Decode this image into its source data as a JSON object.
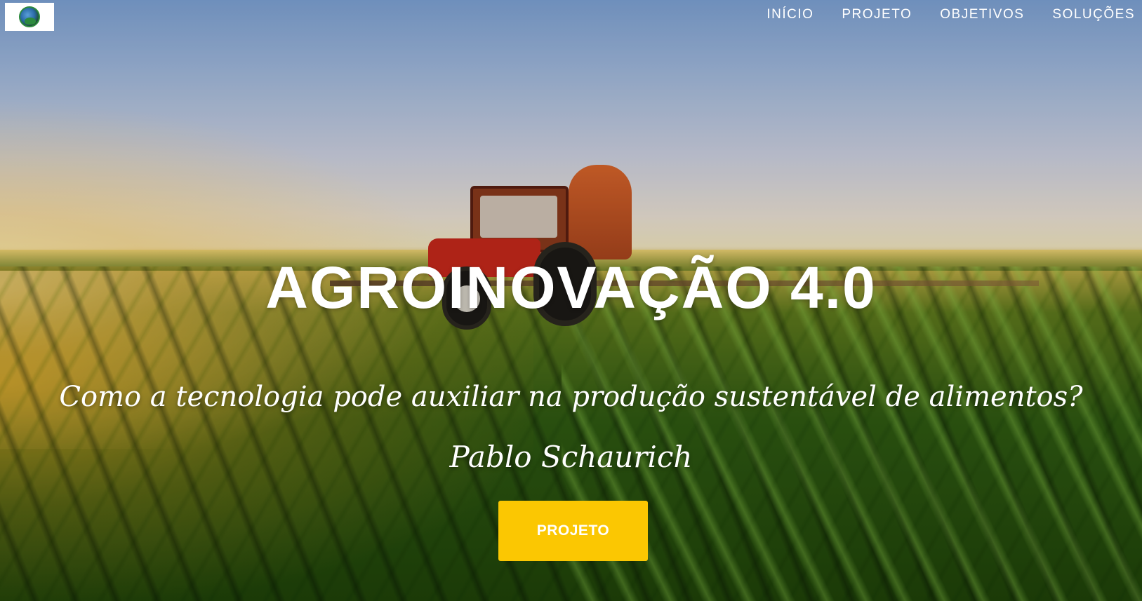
{
  "nav": {
    "logo_alt": "AgroInovação logo",
    "items": [
      {
        "label": "INÍCIO"
      },
      {
        "label": "PROJETO"
      },
      {
        "label": "OBJETIVOS"
      },
      {
        "label": "SOLUÇÕES"
      }
    ]
  },
  "hero": {
    "title": "AGROINOVAÇÃO 4.0",
    "subtitle": "Como a tecnologia pode auxiliar na produção sustentável de alimentos?",
    "author": "Pablo Schaurich",
    "cta_label": "PROJETO",
    "background_icon": "tractor-field-image"
  },
  "colors": {
    "cta_background": "#fbc702",
    "text": "#ffffff"
  }
}
